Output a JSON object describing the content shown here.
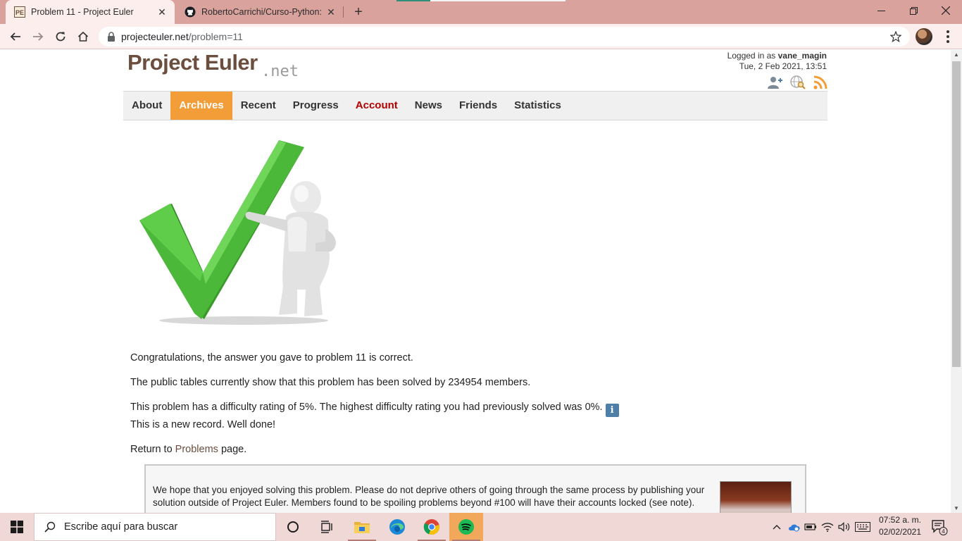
{
  "browser": {
    "tabs": [
      {
        "title": "Problem 11 - Project Euler",
        "active": true
      },
      {
        "title": "RobertoCarrichi/Curso-Python: C",
        "active": false
      }
    ],
    "url_host": "projecteuler.net",
    "url_path": "/problem=11"
  },
  "site": {
    "logo_main": "Project Euler",
    "logo_suffix": ".net",
    "logged_in_prefix": "Logged in as ",
    "username": "vane_magin",
    "datetime": "Tue, 2 Feb 2021, 13:51",
    "nav": [
      "About",
      "Archives",
      "Recent",
      "Progress",
      "Account",
      "News",
      "Friends",
      "Statistics"
    ],
    "active_nav": "Archives"
  },
  "content": {
    "congrats": "Congratulations, the answer you gave to problem 11 is correct.",
    "solved_by": "The public tables currently show that this problem has been solved by 234954 members.",
    "difficulty": "This problem has a difficulty rating of 5%. The highest difficulty rating you had previously solved was 0%.",
    "record": "This is a new record. Well done!",
    "return_prefix": "Return to ",
    "return_link": "Problems",
    "return_suffix": " page.",
    "info_icon_glyph": "i"
  },
  "spoiler_notice": {
    "text": "We hope that you enjoyed solving this problem. Please do not deprive others of going through the same process by publishing your solution outside of Project Euler. Members found to be spoiling problems beyond #100 will have their accounts locked (see note)."
  },
  "taskbar": {
    "search_placeholder": "Escribe aquí para buscar",
    "time": "07:52 a. m.",
    "date": "02/02/2021",
    "notifications": "4"
  },
  "icons": {
    "check_color": "#4cb83a",
    "nav_active_color": "#f29d38",
    "account_color": "#b30000",
    "rss_color": "#f29d38"
  }
}
